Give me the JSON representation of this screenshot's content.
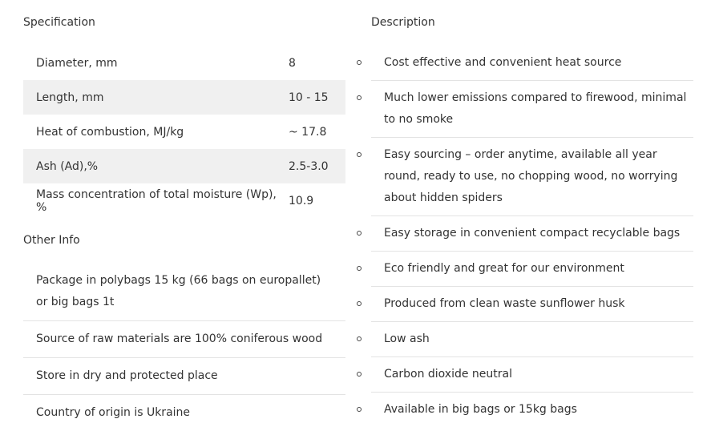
{
  "specification": {
    "title": "Specification",
    "rows": [
      {
        "label": "Diameter, mm",
        "value": "8"
      },
      {
        "label": "Length, mm",
        "value": "10 - 15"
      },
      {
        "label": "Heat of combustion, MJ/kg",
        "value": "~ 17.8"
      },
      {
        "label": "Ash (Ad),%",
        "value": "2.5-3.0"
      },
      {
        "label": "Mass concentration of total moisture (Wp), %",
        "value": "10.9"
      }
    ]
  },
  "other_info": {
    "title": "Other Info",
    "items": [
      "Package in polybags 15 kg (66 bags on europallet) or big bags 1t",
      "Source of raw materials are 100% coniferous wood",
      "Store in dry and protected place",
      "Country of origin is Ukraine"
    ]
  },
  "description": {
    "title": "Description",
    "items": [
      "Cost effective and convenient heat source",
      "Much lower emissions compared to firewood, minimal to no smoke",
      "Easy sourcing – order anytime, available all year round, ready to use, no chopping wood, no worrying about hidden spiders",
      "Easy storage in convenient compact recyclable bags",
      "Eco friendly and great for our environment",
      "Produced from clean waste sunflower husk",
      "Low ash",
      "Carbon dioxide neutral",
      "Available in big bags or 15kg bags"
    ]
  }
}
